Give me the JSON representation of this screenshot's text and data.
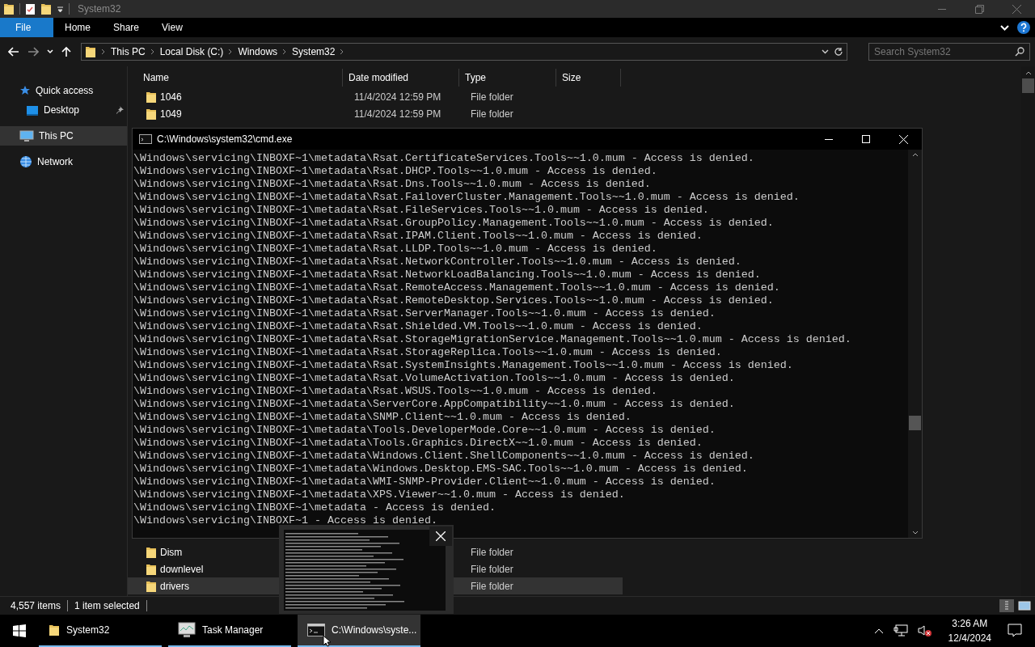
{
  "explorer": {
    "title": "System32",
    "ribbon_tabs": [
      {
        "label": "File",
        "selected": true
      },
      {
        "label": "Home",
        "selected": false
      },
      {
        "label": "Share",
        "selected": false
      },
      {
        "label": "View",
        "selected": false
      }
    ],
    "breadcrumb": [
      "This PC",
      "Local Disk (C:)",
      "Windows",
      "System32"
    ],
    "search": {
      "placeholder": "Search System32"
    },
    "sidebar": [
      {
        "label": "Quick access",
        "kind": "quick",
        "selected": false,
        "children": [
          {
            "label": "Desktop",
            "kind": "desktop",
            "selected": false,
            "pinned": true
          }
        ]
      },
      {
        "label": "This PC",
        "kind": "pc",
        "selected": true
      },
      {
        "label": "Network",
        "kind": "network",
        "selected": false
      }
    ],
    "columns": [
      "Name",
      "Date modified",
      "Type",
      "Size"
    ],
    "rows_top": [
      {
        "name": "1046",
        "date": "11/4/2024 12:59 PM",
        "type": "File folder",
        "selected": false
      },
      {
        "name": "1049",
        "date": "11/4/2024 12:59 PM",
        "type": "File folder",
        "selected": false
      }
    ],
    "rows_bottom": [
      {
        "name": "Dism",
        "type": "File folder",
        "selected": false
      },
      {
        "name": "downlevel",
        "type": "File folder",
        "selected": false
      },
      {
        "name": "drivers",
        "type": "File folder",
        "selected": true
      }
    ],
    "status": {
      "item_count": "4,557 items",
      "selection": "1 item selected"
    }
  },
  "cmd": {
    "title": "C:\\Windows\\system32\\cmd.exe",
    "lines": [
      "\\Windows\\servicing\\INBOXF~1\\metadata\\Rsat.CertificateServices.Tools~~1.0.mum - Access is denied.",
      "\\Windows\\servicing\\INBOXF~1\\metadata\\Rsat.DHCP.Tools~~1.0.mum - Access is denied.",
      "\\Windows\\servicing\\INBOXF~1\\metadata\\Rsat.Dns.Tools~~1.0.mum - Access is denied.",
      "\\Windows\\servicing\\INBOXF~1\\metadata\\Rsat.FailoverCluster.Management.Tools~~1.0.mum - Access is denied.",
      "\\Windows\\servicing\\INBOXF~1\\metadata\\Rsat.FileServices.Tools~~1.0.mum - Access is denied.",
      "\\Windows\\servicing\\INBOXF~1\\metadata\\Rsat.GroupPolicy.Management.Tools~~1.0.mum - Access is denied.",
      "\\Windows\\servicing\\INBOXF~1\\metadata\\Rsat.IPAM.Client.Tools~~1.0.mum - Access is denied.",
      "\\Windows\\servicing\\INBOXF~1\\metadata\\Rsat.LLDP.Tools~~1.0.mum - Access is denied.",
      "\\Windows\\servicing\\INBOXF~1\\metadata\\Rsat.NetworkController.Tools~~1.0.mum - Access is denied.",
      "\\Windows\\servicing\\INBOXF~1\\metadata\\Rsat.NetworkLoadBalancing.Tools~~1.0.mum - Access is denied.",
      "\\Windows\\servicing\\INBOXF~1\\metadata\\Rsat.RemoteAccess.Management.Tools~~1.0.mum - Access is denied.",
      "\\Windows\\servicing\\INBOXF~1\\metadata\\Rsat.RemoteDesktop.Services.Tools~~1.0.mum - Access is denied.",
      "\\Windows\\servicing\\INBOXF~1\\metadata\\Rsat.ServerManager.Tools~~1.0.mum - Access is denied.",
      "\\Windows\\servicing\\INBOXF~1\\metadata\\Rsat.Shielded.VM.Tools~~1.0.mum - Access is denied.",
      "\\Windows\\servicing\\INBOXF~1\\metadata\\Rsat.StorageMigrationService.Management.Tools~~1.0.mum - Access is denied.",
      "\\Windows\\servicing\\INBOXF~1\\metadata\\Rsat.StorageReplica.Tools~~1.0.mum - Access is denied.",
      "\\Windows\\servicing\\INBOXF~1\\metadata\\Rsat.SystemInsights.Management.Tools~~1.0.mum - Access is denied.",
      "\\Windows\\servicing\\INBOXF~1\\metadata\\Rsat.VolumeActivation.Tools~~1.0.mum - Access is denied.",
      "\\Windows\\servicing\\INBOXF~1\\metadata\\Rsat.WSUS.Tools~~1.0.mum - Access is denied.",
      "\\Windows\\servicing\\INBOXF~1\\metadata\\ServerCore.AppCompatibility~~1.0.mum - Access is denied.",
      "\\Windows\\servicing\\INBOXF~1\\metadata\\SNMP.Client~~1.0.mum - Access is denied.",
      "\\Windows\\servicing\\INBOXF~1\\metadata\\Tools.DeveloperMode.Core~~1.0.mum - Access is denied.",
      "\\Windows\\servicing\\INBOXF~1\\metadata\\Tools.Graphics.DirectX~~1.0.mum - Access is denied.",
      "\\Windows\\servicing\\INBOXF~1\\metadata\\Windows.Client.ShellComponents~~1.0.mum - Access is denied.",
      "\\Windows\\servicing\\INBOXF~1\\metadata\\Windows.Desktop.EMS-SAC.Tools~~1.0.mum - Access is denied.",
      "\\Windows\\servicing\\INBOXF~1\\metadata\\WMI-SNMP-Provider.Client~~1.0.mum - Access is denied.",
      "\\Windows\\servicing\\INBOXF~1\\metadata\\XPS.Viewer~~1.0.mum - Access is denied.",
      "\\Windows\\servicing\\INBOXF~1\\metadata - Access is denied.",
      "\\Windows\\servicing\\INBOXF~1 - Access is denied."
    ]
  },
  "taskbar": {
    "items": [
      {
        "label": "System32",
        "kind": "explorer",
        "selected": false
      },
      {
        "label": "Task Manager",
        "kind": "taskmgr",
        "selected": false
      },
      {
        "label": "C:\\Windows\\syste...",
        "kind": "cmd",
        "selected": true
      }
    ],
    "time": "3:26 AM",
    "date": "12/4/2024"
  }
}
